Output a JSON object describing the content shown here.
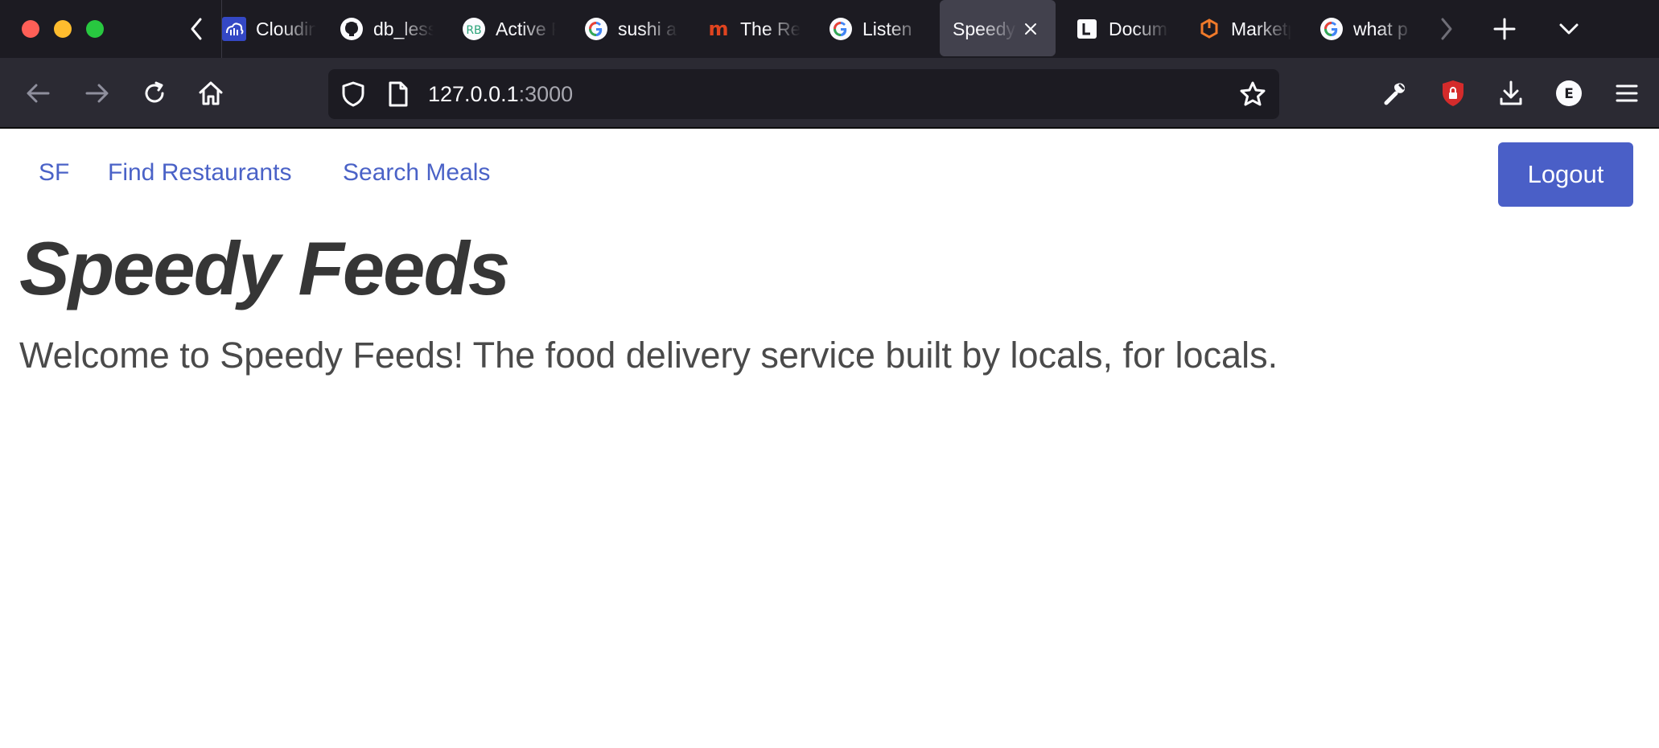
{
  "browser": {
    "tabs": [
      {
        "title": "Cloudinary",
        "icon": "cloudinary-icon"
      },
      {
        "title": "db_lessons",
        "icon": "github-icon"
      },
      {
        "title": "Active Record",
        "icon": "rb-icon"
      },
      {
        "title": "sushi and",
        "icon": "google-icon"
      },
      {
        "title": "The Real",
        "icon": "m-icon"
      },
      {
        "title": "Listen",
        "icon": "google-icon"
      },
      {
        "title": "SpeedyFeeds",
        "icon": "",
        "active": true
      },
      {
        "title": "Documentation",
        "icon": "l-icon"
      },
      {
        "title": "Marketplace",
        "icon": "marketplace-icon"
      },
      {
        "title": "what p",
        "icon": "google-icon"
      }
    ],
    "url_host": "127.0.0.1",
    "url_port": ":3000",
    "colors": {
      "tabstrip_bg": "#1c1b22",
      "toolbar_bg": "#2b2a33",
      "active_tab_bg": "#42414d"
    }
  },
  "site": {
    "nav": {
      "brand": "SF",
      "find_restaurants": "Find Restaurants",
      "search_meals": "Search Meals",
      "logout": "Logout"
    },
    "title": "Speedy Feeds",
    "welcome": "Welcome to Speedy Feeds! The food delivery service built by locals, for locals.",
    "colors": {
      "link": "#4a62c7",
      "button": "#4a5fc7",
      "heading": "#363636"
    }
  }
}
